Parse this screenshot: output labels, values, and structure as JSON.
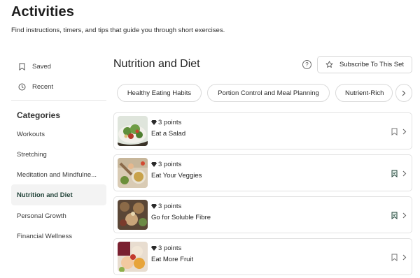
{
  "header": {
    "title": "Activities",
    "subtitle": "Find instructions, timers, and tips that guide you through short exercises."
  },
  "sidebar": {
    "saved_label": "Saved",
    "recent_label": "Recent",
    "categories_heading": "Categories",
    "categories": [
      {
        "label": "Workouts",
        "active": false
      },
      {
        "label": "Stretching",
        "active": false
      },
      {
        "label": "Meditation and Mindfulne...",
        "active": false
      },
      {
        "label": "Nutrition and Diet",
        "active": true
      },
      {
        "label": "Personal Growth",
        "active": false
      },
      {
        "label": "Financial Wellness",
        "active": false
      }
    ]
  },
  "main": {
    "set_title": "Nutrition and Diet",
    "help_icon": "question-circle-icon",
    "subscribe_label": "Subscribe To This Set",
    "chips": [
      "Healthy Eating Habits",
      "Portion Control and Meal Planning",
      "Nutrient-Rich"
    ],
    "activities": [
      {
        "points": "3 points",
        "title": "Eat a Salad",
        "saved": false
      },
      {
        "points": "3 points",
        "title": "Eat Your Veggies",
        "saved": true
      },
      {
        "points": "3 points",
        "title": "Go for Soluble Fibre",
        "saved": true
      },
      {
        "points": "3 points",
        "title": "Eat More Fruit",
        "saved": false
      }
    ]
  },
  "colors": {
    "accent": "#24453b",
    "active_bg": "#f3f3f3",
    "border": "#e2e2e2"
  }
}
